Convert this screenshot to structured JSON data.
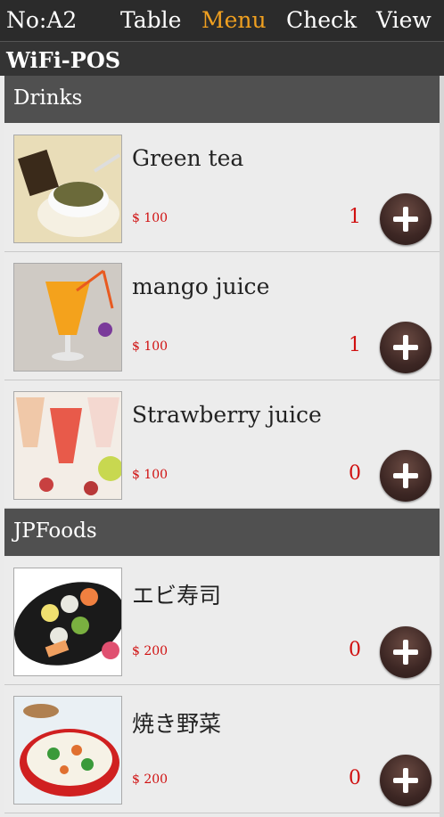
{
  "nav": {
    "table_no": "No:A2",
    "tabs": [
      {
        "label": "Table"
      },
      {
        "label": "Menu"
      },
      {
        "label": "Check"
      },
      {
        "label": "View"
      }
    ]
  },
  "app": {
    "title": "WiFi-POS"
  },
  "categories": [
    {
      "name": "Drinks",
      "items": [
        {
          "name": "Green tea",
          "price": "$ 100",
          "qty": "1"
        },
        {
          "name": "mango juice",
          "price": "$ 100",
          "qty": "1"
        },
        {
          "name": "Strawberry juice",
          "price": "$ 100",
          "qty": "0"
        }
      ]
    },
    {
      "name": "JPFoods",
      "items": [
        {
          "name": "エビ寿司",
          "price": "$ 200",
          "qty": "0"
        },
        {
          "name": "焼き野菜",
          "price": "$ 200",
          "qty": "0"
        }
      ]
    }
  ],
  "icons": {
    "add": "plus-circle-icon"
  },
  "colors": {
    "accent_tab": "#f0a020",
    "price": "#d01010",
    "qty": "#d01010"
  }
}
